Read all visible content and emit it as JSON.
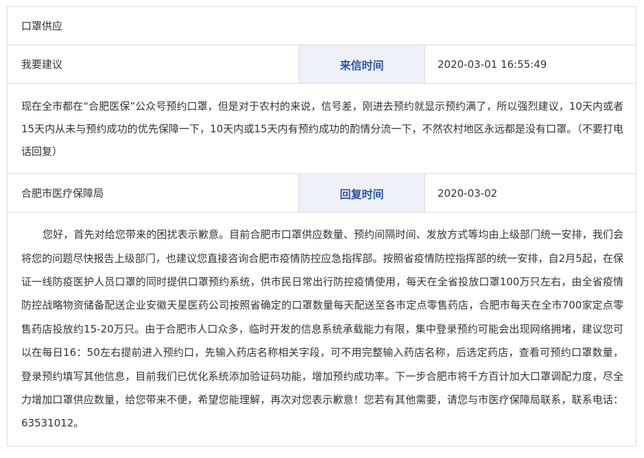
{
  "title": "口罩供应",
  "letter": {
    "type": "我要建议",
    "time_label": "来信时间",
    "time_value": "2020-03-01 16:55:49",
    "content": "现在全市都在“合肥医保”公众号预约口罩，但是对于农村的来说，信号差，刚进去预约就显示预约满了，所以强烈建议，10天内或者15天内从未与预约成功的优先保障一下，10天内或15天内有预约成功的酌情分流一下，不然农村地区永远都是没有口罩。（不要打电话回复）"
  },
  "reply": {
    "department": "合肥市医疗保障局",
    "time_label": "回复时间",
    "time_value": "2020-03-02",
    "content": "您好，首先对给您带来的困扰表示歉意。目前合肥市口罩供应数量、预约间隔时间、发放方式等均由上级部门统一安排，我们会将您的问题尽快报告上级部门，也建议您直接咨询合肥市疫情防控应急指挥部。按照省疫情防控指挥部的统一安排，自2月5起，在保证一线防疫医护人员口罩的同时提供口罩预约系统，供市民日常出行防控疫情使用，每天在全省投放口罩100万只左右，由全省疫情防控战略物资储备配送企业安徽天星医药公司按照省确定的口罩数量每天配送至各市定点零售药店，合肥市每天在全市700家定点零售药店投放约15-20万只。由于合肥市人口众多，临时开发的信息系统承载能力有限，集中登录预约可能会出现网络拥堵，建议您可以在每日16：50左右提前进入预约口，先输入药店名称相关字段，可不用完整输入药店名称，后选定药店，查看可预约口罩数量，登录预约填写其他信息，目前我们已优化系统添加验证码功能，增加预约成功率。下一步合肥市将千方百计加大口罩调配力度，尽全力增加口罩供应数量，给您带来不便，希望您能理解，再次对您表示歉意！您若有其他需要，请您与市医疗保障局联系，联系电话：63531012。"
  },
  "colors": {
    "label_bg": "#eef1f8",
    "label_text": "#2a54a8",
    "border": "#dcdcdc",
    "text": "#333333"
  }
}
